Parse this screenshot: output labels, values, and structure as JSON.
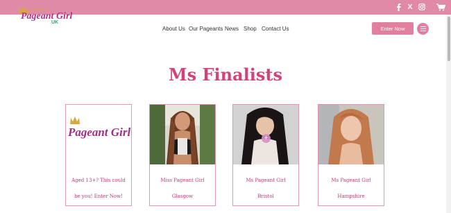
{
  "topbar": {
    "social_icons": [
      "facebook-icon",
      "x-icon",
      "instagram-icon",
      "cart-icon"
    ],
    "x_glyph": "X",
    "color": "#e18aa8"
  },
  "header": {
    "logo": {
      "tagline": "The Home of",
      "name": "Pageant Girl",
      "suffix": "UK"
    },
    "nav": [
      "About Us",
      "Our Pageants",
      "News",
      "Shop",
      "Contact Us"
    ],
    "cta_label": "Enter Now",
    "accent": "#e27f9f"
  },
  "main": {
    "title": "Ms Finalists",
    "title_color": "#d2437b",
    "cards": [
      {
        "image": "pageant-girl-logo",
        "logo_text": "Pageant Girl",
        "line1": "Aged 13+? This could",
        "line2": "be you! Enter Now!"
      },
      {
        "image": "finalist-photo",
        "line1": "Miss Pageant Girl",
        "line2": "Glasgow"
      },
      {
        "image": "finalist-photo",
        "line1": "Ms Pageant Girl",
        "line2": "Bristol"
      },
      {
        "image": "finalist-photo",
        "line1": "Ms Pageant Girl",
        "line2": "Hampshire"
      }
    ]
  }
}
